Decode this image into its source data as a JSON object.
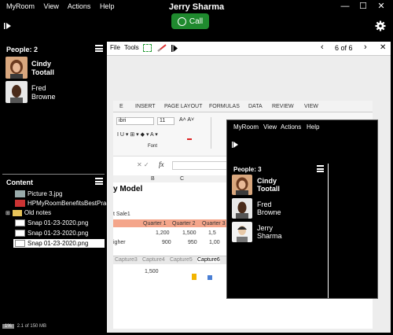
{
  "app": {
    "menu": [
      "MyRoom",
      "View",
      "Actions",
      "Help"
    ],
    "title": "Jerry Sharma",
    "call_label": "Call"
  },
  "window_controls": {
    "minimize": "—",
    "maximize": "☐",
    "close": "✕"
  },
  "people": {
    "title": "People: 2",
    "items": [
      {
        "first": "Cindy",
        "last": "Tootall",
        "bold": true
      },
      {
        "first": "Fred",
        "last": "Browne",
        "bold": false
      }
    ]
  },
  "content": {
    "title": "Content",
    "items": [
      {
        "label": "Picture 3.jpg",
        "icon": "image-icon",
        "selected": false
      },
      {
        "label": "HPMyRoomBenefitsBestPrac...",
        "icon": "pdf-icon",
        "selected": false
      },
      {
        "label": "Old notes",
        "icon": "folder-icon",
        "selected": false
      },
      {
        "label": "Snap 01-23-2020.png",
        "icon": "snapshot-icon",
        "selected": false
      },
      {
        "label": "Snap 01-23-2020.png",
        "icon": "snapshot-icon",
        "selected": false
      },
      {
        "label": "Snap 01-23-2020.png",
        "icon": "snapshot-icon",
        "selected": true
      }
    ]
  },
  "status": {
    "percent": "1%",
    "storage": "2.1 of 150 MB",
    "percent_value": 1
  },
  "viewer": {
    "menu": [
      "File",
      "Tools"
    ],
    "page_counter": "6 of 6"
  },
  "excel": {
    "ribbon_tabs": [
      "E",
      "INSERT",
      "PAGE LAYOUT",
      "FORMULAS",
      "DATA",
      "REVIEW",
      "VIEW"
    ],
    "font_name": "ibri",
    "font_size": "11",
    "font_group": "Font",
    "formula_symbol": "fx",
    "columns": [
      "B",
      "C"
    ],
    "sheet_title": "y Model",
    "label_sale": "t Sale1",
    "header_row": [
      "Quarter 1",
      "Quarter 2",
      "Quarter 3"
    ],
    "row1": [
      "1,200",
      "1,500",
      "1,5"
    ],
    "row2_label": "igher",
    "row2": [
      "900",
      "950",
      "1,00"
    ],
    "sheet_tabs": [
      "Capture3",
      "Capture4",
      "Capture5",
      "Capture6"
    ],
    "chart_value": "1,500"
  },
  "inner_window": {
    "menu": [
      "MyRoom",
      "View",
      "Actions",
      "Help"
    ],
    "people_title": "People: 3",
    "people": [
      {
        "first": "Cindy",
        "last": "Tootall",
        "bold": true
      },
      {
        "first": "Fred",
        "last": "Browne",
        "bold": false
      },
      {
        "first": "Jerry",
        "last": "Sharma",
        "bold": false
      }
    ]
  }
}
